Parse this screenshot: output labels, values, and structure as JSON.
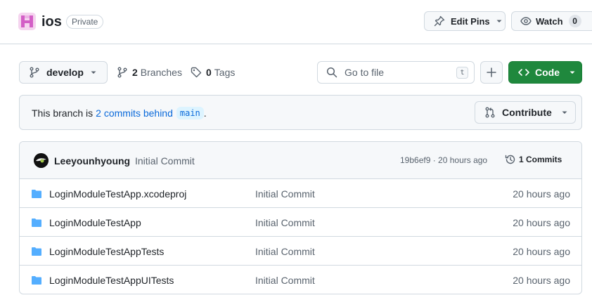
{
  "header": {
    "repo_name": "ios",
    "visibility": "Private",
    "edit_pins_label": "Edit Pins",
    "watch_label": "Watch",
    "watch_count": "0"
  },
  "toolbar": {
    "branch_name": "develop",
    "branches_count": "2",
    "branches_label": "Branches",
    "tags_count": "0",
    "tags_label": "Tags",
    "search_placeholder": "Go to file",
    "search_shortcut": "t",
    "code_label": "Code"
  },
  "branch_status": {
    "prefix": "This branch is",
    "link_text": "2 commits behind",
    "base_branch": "main",
    "suffix": ".",
    "contribute_label": "Contribute"
  },
  "latest_commit": {
    "author": "Leeyounhyoung",
    "message": "Initial Commit",
    "meta": "19b6ef9 · 20 hours ago",
    "commits_label": "1 Commits"
  },
  "files": [
    {
      "name": "LoginModuleTestApp.xcodeproj",
      "commit": "Initial Commit",
      "age": "20 hours ago",
      "icon": "folder-icon"
    },
    {
      "name": "LoginModuleTestApp",
      "commit": "Initial Commit",
      "age": "20 hours ago",
      "icon": "folder-icon"
    },
    {
      "name": "LoginModuleTestAppTests",
      "commit": "Initial Commit",
      "age": "20 hours ago",
      "icon": "folder-icon"
    },
    {
      "name": "LoginModuleTestAppUITests",
      "commit": "Initial Commit",
      "age": "20 hours ago",
      "icon": "folder-icon"
    }
  ],
  "colors": {
    "accent_blue": "#0969da",
    "code_green": "#1f883d",
    "folder_blue": "#54aeff",
    "border": "#d1d9e0"
  }
}
